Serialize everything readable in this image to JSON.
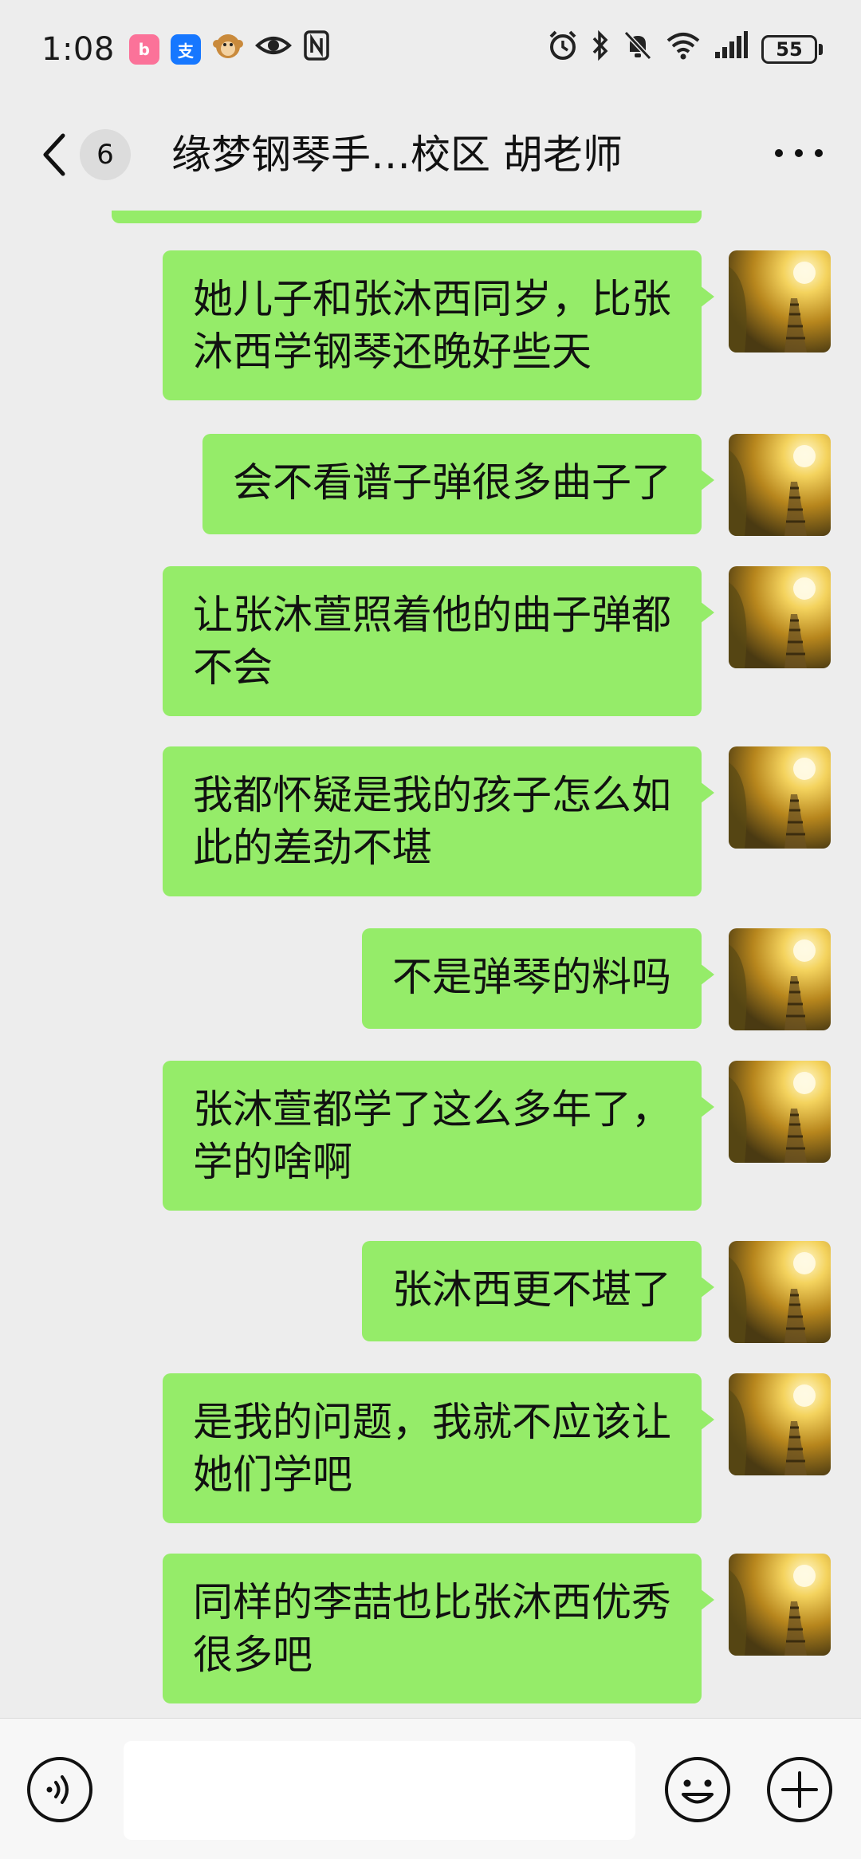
{
  "status_bar": {
    "time": "1:08",
    "battery_level": "55",
    "app_icons": [
      "bilibili-icon",
      "alipay-icon",
      "monkey-app-icon",
      "eye-icon",
      "nfc-icon"
    ],
    "system_icons": [
      "alarm-icon",
      "bluetooth-icon",
      "mute-icon",
      "wifi-icon",
      "signal-icon"
    ]
  },
  "header": {
    "back_count": "6",
    "title": "缘梦钢琴手…校区 胡老师"
  },
  "messages": [
    {
      "text": "她儿子和张沐西同岁，比张\n沐西学钢琴还晚好些天"
    },
    {
      "text": "会不看谱子弹很多曲子了"
    },
    {
      "text": "让张沐萱照着他的曲子弹都\n不会"
    },
    {
      "text": "我都怀疑是我的孩子怎么如\n此的差劲不堪"
    },
    {
      "text": "不是弹琴的料吗"
    },
    {
      "text": "张沐萱都学了这么多年了，\n学的啥啊"
    },
    {
      "text": "张沐西更不堪了"
    },
    {
      "text": "是我的问题，我就不应该让\n她们学吧"
    },
    {
      "text": "同样的李喆也比张沐西优秀\n很多吧"
    }
  ],
  "colors": {
    "bubble": "#95ec69",
    "background": "#ededed",
    "input_bar": "#f7f7f7"
  }
}
